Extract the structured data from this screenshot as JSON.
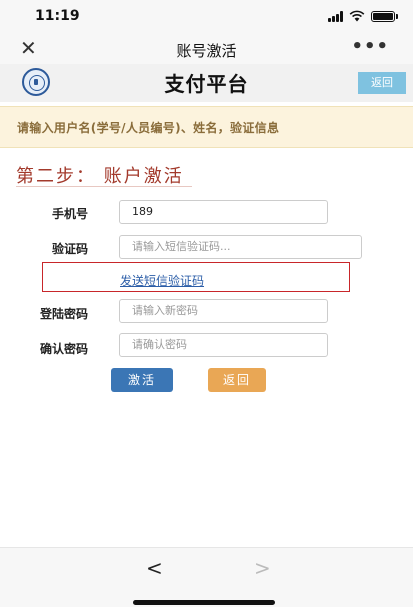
{
  "status_bar": {
    "time": "11:19"
  },
  "nav": {
    "close_glyph": "✕",
    "title": "账号激活",
    "more_glyph": "•••"
  },
  "header": {
    "title": "支付平台",
    "back_label": "返回"
  },
  "notice": {
    "text": "请输入用户名(学号/人员编号)、姓名，验证信息"
  },
  "step": {
    "title": "第二步： 账户激活"
  },
  "form": {
    "phone": {
      "label": "手机号",
      "value": "189"
    },
    "code": {
      "label": "验证码",
      "placeholder": "请输入短信验证码..."
    },
    "send_code_link": "发送短信验证码",
    "password": {
      "label": "登陆密码",
      "placeholder": "请输入新密码"
    },
    "confirm": {
      "label": "确认密码",
      "placeholder": "请确认密码"
    }
  },
  "buttons": {
    "activate": "激活",
    "back": "返回"
  },
  "bottom_nav": {
    "prev_glyph": "<",
    "next_glyph": ">"
  },
  "colors": {
    "step_title": "#a33a2c",
    "activate_button": "#3b76b5",
    "back_button": "#e9a755",
    "header_back_button": "#7fc2e0",
    "notice_bg": "#fcf3dd",
    "highlight_box": "#c8262a"
  }
}
